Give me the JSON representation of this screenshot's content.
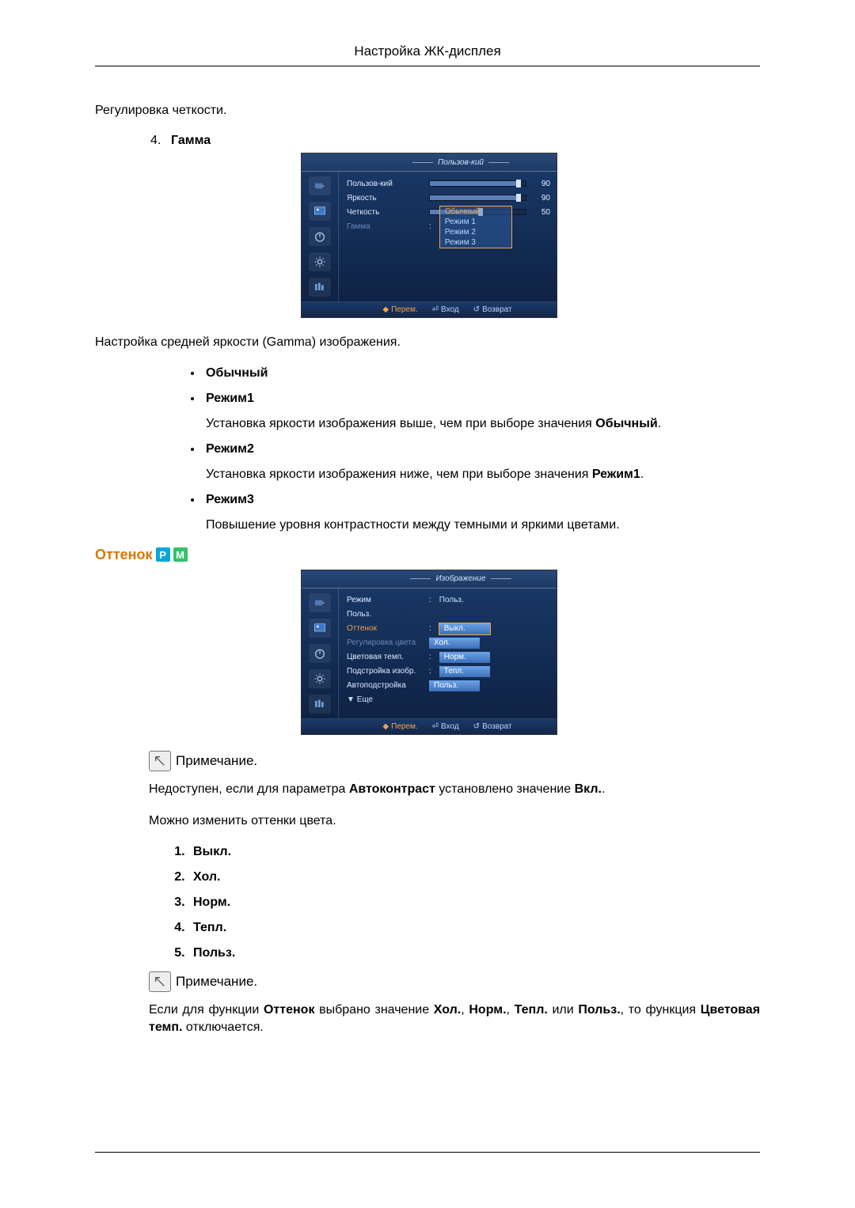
{
  "header": {
    "title": "Настройка ЖК-дисплея"
  },
  "sharpness_text": "Регулировка четкости.",
  "item4": {
    "num": "4.",
    "title": "Гамма"
  },
  "osd_gamma": {
    "panel_title": "Пользов-кий",
    "rows": [
      {
        "label": "Пользов-кий",
        "val": 90,
        "pct": 90
      },
      {
        "label": "Яркость",
        "val": 90,
        "pct": 90
      },
      {
        "label": "Четкость",
        "val": 50,
        "pct": 50
      }
    ],
    "gamma_label": "Гамма",
    "gamma_options": [
      "Обычный",
      "Режим 1",
      "Режим 2",
      "Режим 3"
    ],
    "footer": {
      "move": "Перем.",
      "enter": "Вход",
      "return": "Возврат"
    }
  },
  "gamma_desc": "Настройка средней яркости (Gamma) изображения.",
  "gamma_modes": {
    "normal": "Обычный",
    "m1": "Режим1",
    "m1_desc_pre": "Установка яркости изображения выше, чем при выборе значения ",
    "m1_desc_bold": "Обычный",
    "m2": "Режим2",
    "m2_desc_pre": "Установка яркости изображения ниже, чем при выборе значения ",
    "m2_desc_bold": "Режим1",
    "m3": "Режим3",
    "m3_desc": "Повышение уровня контрастности между темными и яркими цветами."
  },
  "tone_section": {
    "title": "Оттенок",
    "badge1": "P",
    "badge2": "M"
  },
  "osd_tone": {
    "panel_title": "Изображение",
    "rows": [
      {
        "label": "Режим",
        "val": "Польз."
      },
      {
        "label": "Польз."
      },
      {
        "label": "Оттенок",
        "highlight": true,
        "sel": "Выкл."
      },
      {
        "label": "Регулировка цвета",
        "dim": true,
        "sel": "Хол."
      },
      {
        "label": "Цветовая темп.",
        "sel": "Норм."
      },
      {
        "label": "Подстройка изобр.",
        "sel": "Тепл."
      },
      {
        "label": "Автоподстройка",
        "sel": "Польз."
      }
    ],
    "more": "Еще",
    "footer": {
      "move": "Перем.",
      "enter": "Вход",
      "return": "Возврат"
    }
  },
  "note": {
    "label": "Примечание."
  },
  "note_text_parts": {
    "pre": "Недоступен, если для параметра ",
    "b1": "Автоконтраст",
    "mid": " установлено значение ",
    "b2": "Вкл.",
    "end": "."
  },
  "change_text": "Можно изменить оттенки цвета.",
  "tone_list": [
    "Выкл.",
    "Хол.",
    "Норм.",
    "Тепл.",
    "Польз."
  ],
  "note2_parts": {
    "p1": "Если для функции ",
    "b_tone": "Оттенок",
    "p2": " выбрано значение ",
    "b_cold": "Хол.",
    "c1": ", ",
    "b_norm": "Норм.",
    "c2": ", ",
    "b_warm": "Тепл.",
    "p3": " или ",
    "b_user": "Польз.",
    "p4": ", то функция ",
    "b_ct": "Цветовая темп.",
    "p5": " отключается."
  }
}
